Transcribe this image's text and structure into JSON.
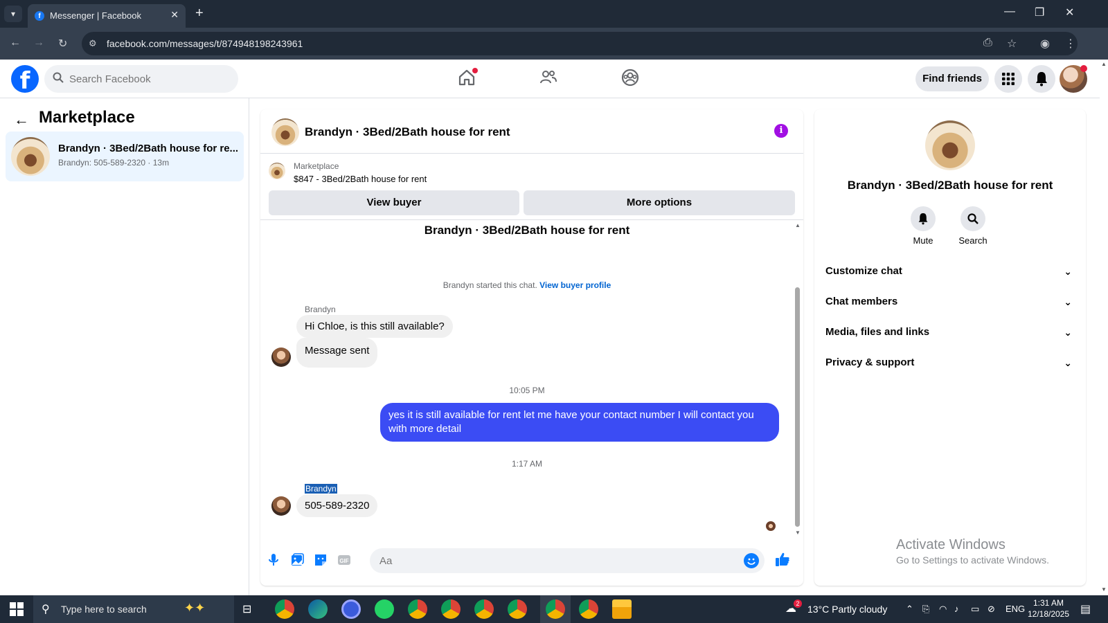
{
  "browser": {
    "tab_title": "Messenger | Facebook",
    "url": "facebook.com/messages/t/874948198243961"
  },
  "fb": {
    "search_placeholder": "Search Facebook",
    "find_friends": "Find friends"
  },
  "left": {
    "title": "Marketplace",
    "conversation": {
      "name": "Brandyn · 3Bed/2Bath house for re...",
      "preview": "Brandyn: 505-589-2320 · 13m"
    }
  },
  "chat": {
    "header_title": "Brandyn · 3Bed/2Bath house for rent",
    "marketplace_label": "Marketplace",
    "listing": "$847 - 3Bed/2Bath house for rent",
    "view_buyer": "View buyer",
    "more_options": "More options",
    "convo_title": "Brandyn · 3Bed/2Bath house for rent",
    "started_text": "Brandyn started this chat.",
    "view_buyer_profile": "View buyer profile",
    "messages": [
      {
        "sender": "Brandyn",
        "text": "Hi Chloe, is this still available?"
      },
      {
        "text": "Message sent"
      },
      {
        "timestamp": "10:05 PM"
      },
      {
        "text": "yes it is still available for rent let me have your contact number I will contact you with more detail"
      },
      {
        "timestamp": "1:17 AM"
      },
      {
        "sender": "Brandyn",
        "text": "505-589-2320"
      }
    ],
    "composer_placeholder": "Aa"
  },
  "right": {
    "title": "Brandyn · 3Bed/2Bath house for rent",
    "mute": "Mute",
    "search": "Search",
    "sections": [
      "Customize chat",
      "Chat members",
      "Media, files and links",
      "Privacy & support"
    ]
  },
  "watermark": {
    "line1": "Activate Windows",
    "line2": "Go to Settings to activate Windows."
  },
  "taskbar": {
    "search": "Type here to search",
    "weather": "13°C  Partly cloudy",
    "lang": "ENG",
    "time": "1:31 AM",
    "date": "12/18/2025",
    "weather_badge": "2"
  },
  "colors": {
    "fb_blue": "#0866ff",
    "outgoing_bubble": "#3b4cf4",
    "incoming_bubble": "#f0f0f0",
    "link": "#0064d1",
    "info": "#a10fe3"
  }
}
